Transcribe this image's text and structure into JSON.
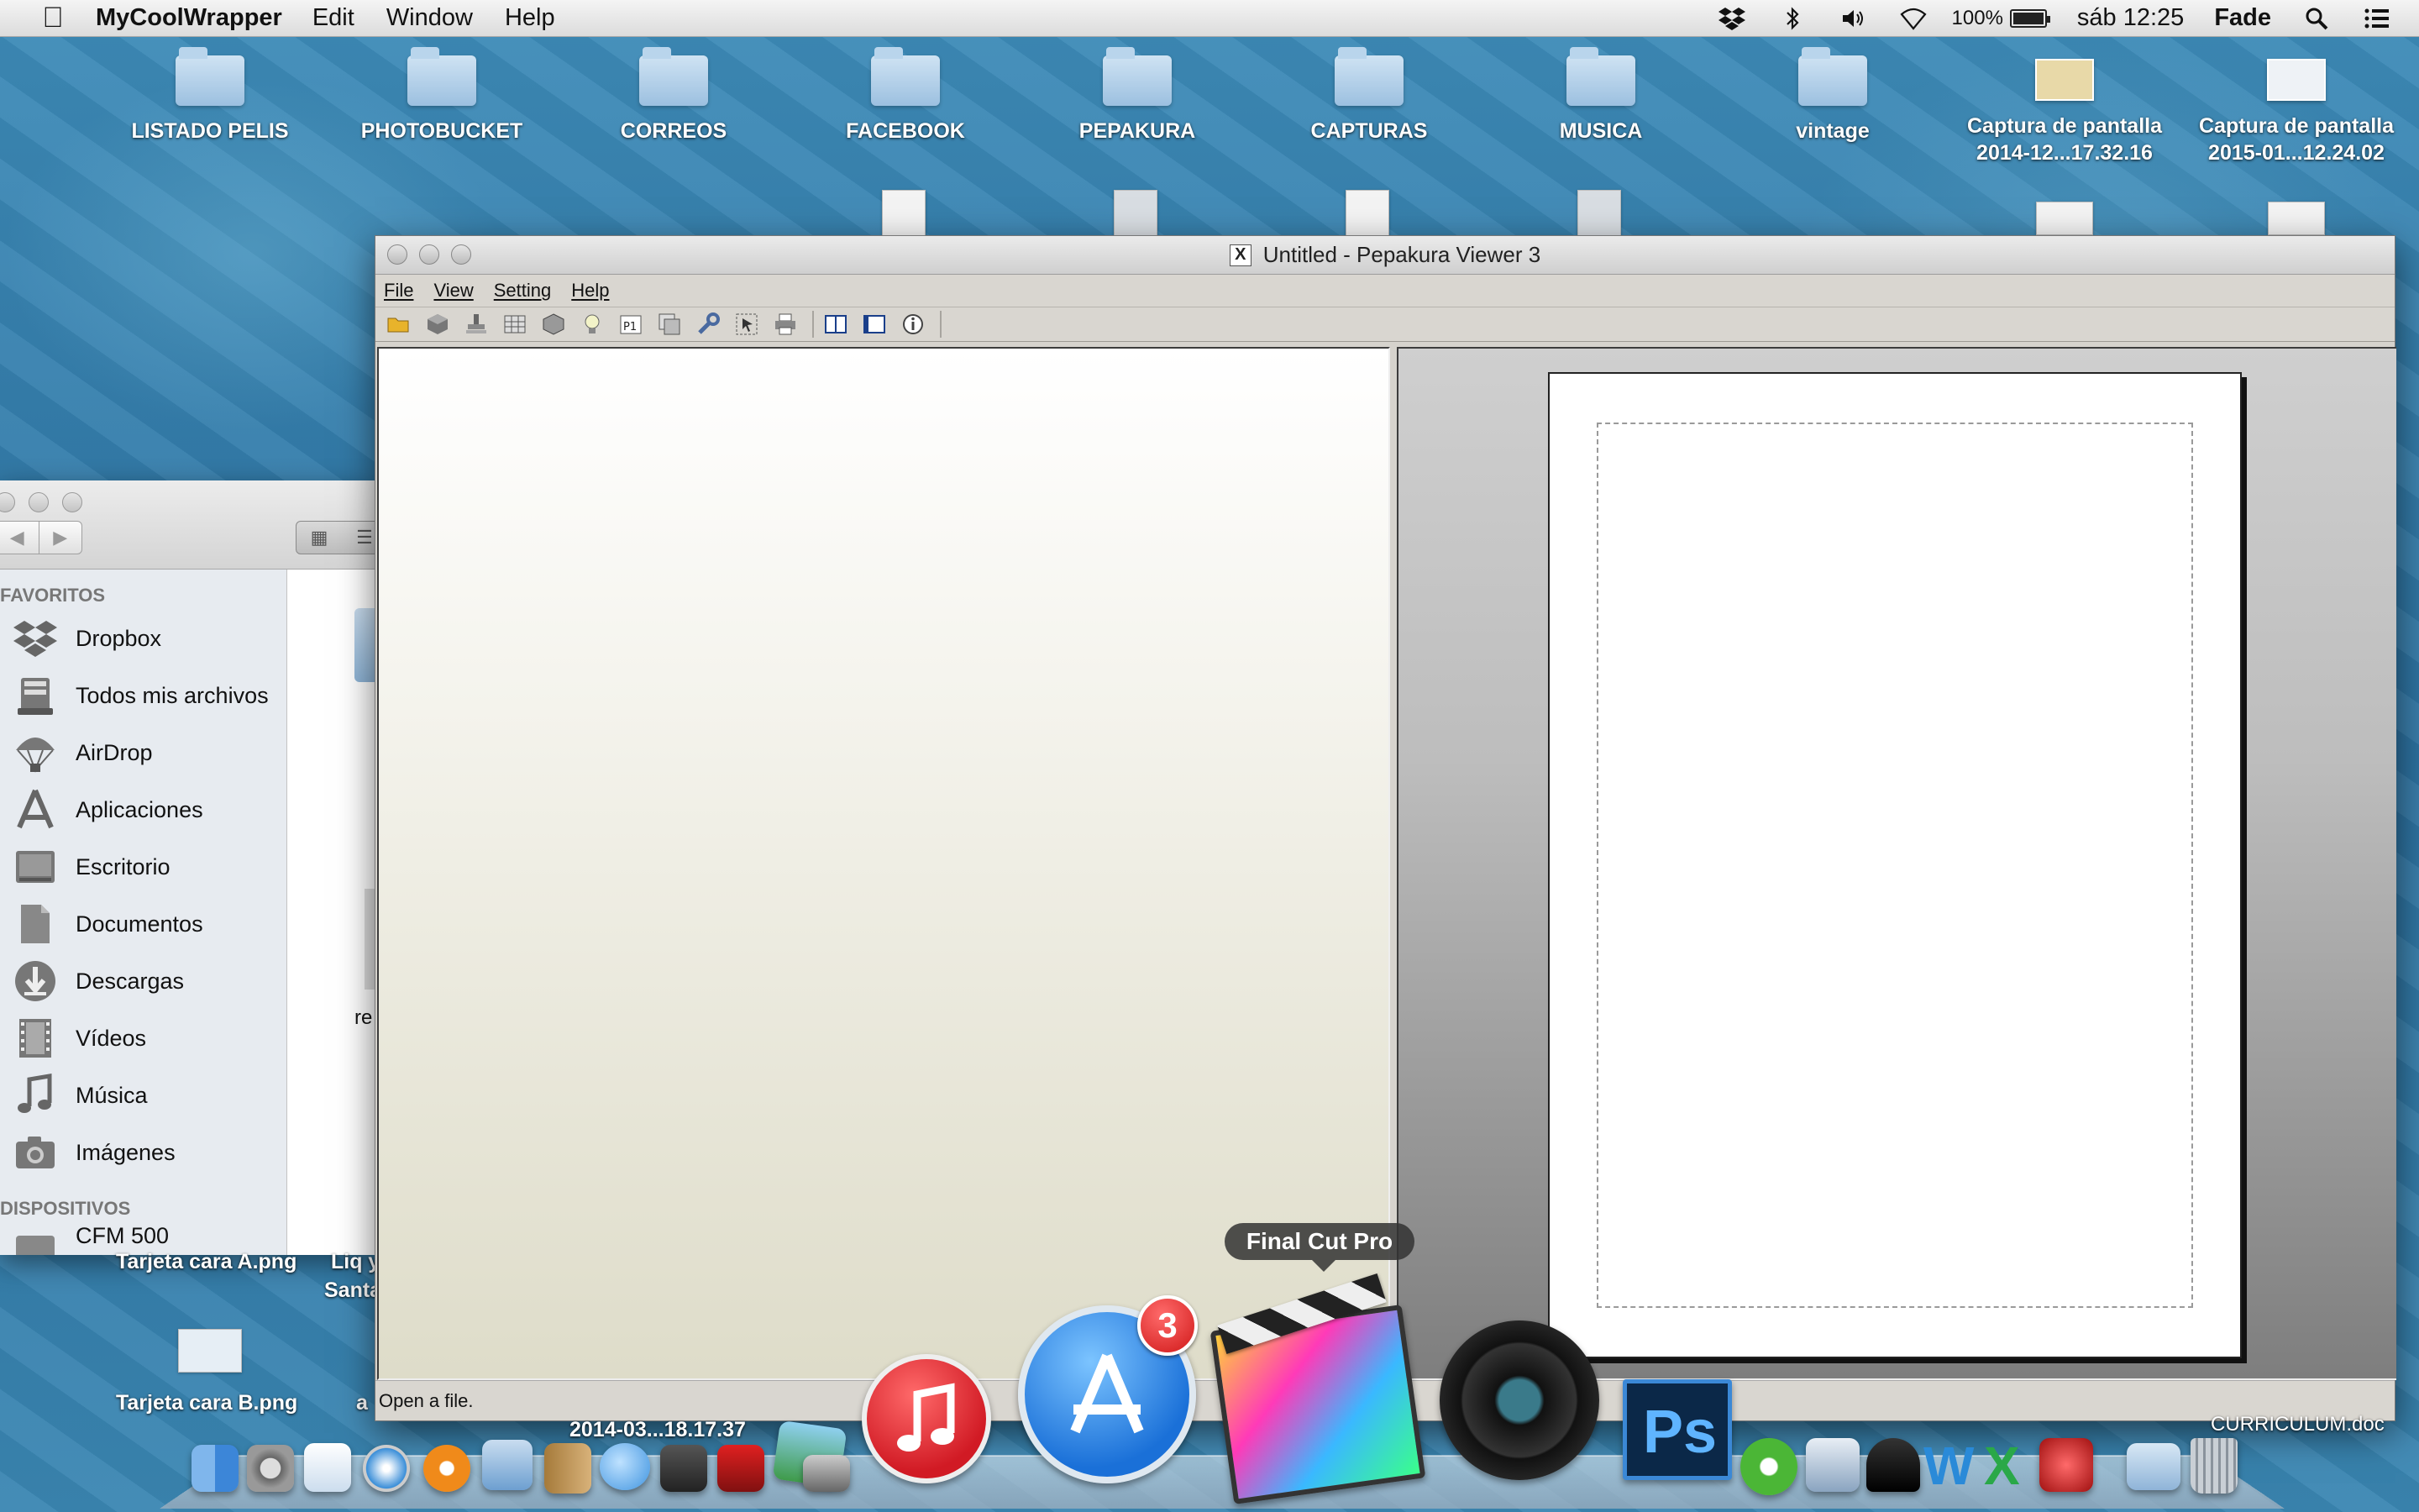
{
  "menubar": {
    "app_name": "MyCoolWrapper",
    "menus": [
      "Edit",
      "Window",
      "Help"
    ],
    "battery_text": "100%",
    "battery_level": 1.0,
    "clock": "sáb 12:25",
    "user": "Fade",
    "tray_icons": [
      "dropbox-icon",
      "bluetooth-icon",
      "volume-icon",
      "wifi-icon",
      "battery-icon",
      "spotlight-icon",
      "notifications-icon"
    ]
  },
  "desktop": {
    "folders": [
      {
        "label": "LISTADO PELIS"
      },
      {
        "label": "PHOTOBUCKET"
      },
      {
        "label": "CORREOS"
      },
      {
        "label": "FACEBOOK"
      },
      {
        "label": "PEPAKURA"
      },
      {
        "label": "CAPTURAS"
      },
      {
        "label": "MUSICA"
      },
      {
        "label": "vintage"
      }
    ],
    "screenshots": [
      {
        "line1": "Captura de pantalla",
        "line2": "2014-12...17.32.16"
      },
      {
        "line1": "Captura de pantalla",
        "line2": "2015-01...12.24.02"
      }
    ],
    "bottom_files": [
      {
        "label": "Tarjeta cara A.png"
      },
      {
        "label": "Tarjeta cara B.png"
      },
      {
        "label": "Liq y"
      },
      {
        "label": "Santa"
      },
      {
        "label": "a"
      },
      {
        "label": "2014-03...18.17.37"
      },
      {
        "label": "CURRICULUM.doc"
      }
    ]
  },
  "finder": {
    "sections": {
      "favorites": "FAVORITOS",
      "devices": "DISPOSITIVOS"
    },
    "favorites": [
      {
        "label": "Dropbox",
        "icon": "dropbox-icon"
      },
      {
        "label": "Todos mis archivos",
        "icon": "all-files-icon"
      },
      {
        "label": "AirDrop",
        "icon": "airdrop-icon"
      },
      {
        "label": "Aplicaciones",
        "icon": "applications-icon"
      },
      {
        "label": "Escritorio",
        "icon": "desktop-icon"
      },
      {
        "label": "Documentos",
        "icon": "documents-icon"
      },
      {
        "label": "Descargas",
        "icon": "downloads-icon"
      },
      {
        "label": "Vídeos",
        "icon": "movies-icon"
      },
      {
        "label": "Música",
        "icon": "music-icon"
      },
      {
        "label": "Imágenes",
        "icon": "pictures-icon"
      }
    ],
    "devices": [
      {
        "label": "CFM 500"
      }
    ],
    "partial_file_label": "re"
  },
  "pepakura": {
    "title": "Untitled - Pepakura Viewer 3",
    "menus": [
      "File",
      "View",
      "Setting",
      "Help"
    ],
    "toolbar": [
      "open-folder-icon",
      "3d-model-icon",
      "print-stamp-icon",
      "unfold-icon",
      "box-icon",
      "bulb-icon",
      "page-p1-icon",
      "layout-icon",
      "wrench-icon",
      "select-icon",
      "print-icon",
      "split-view-icon",
      "single-view-icon",
      "info-icon"
    ],
    "status": "Open a file."
  },
  "dock": {
    "tooltip": "Final Cut Pro",
    "app_store_badge": "3",
    "apps": [
      "finder",
      "system-preferences",
      "preview",
      "safari",
      "ibooks",
      "mail-stamp",
      "contacts",
      "messages",
      "facetime",
      "photo-booth",
      "iphoto",
      "image-capture",
      "itunes",
      "app-store",
      "final-cut-pro",
      "aperture",
      "photoshop",
      "utorrent",
      "network-share",
      "inkscape",
      "word",
      "excel",
      "wineskin",
      "downloads-folder",
      "trash"
    ]
  },
  "colors": {
    "wallpaper": "#2e74a3",
    "badge_red": "#d01818",
    "itunes_red": "#e0242c",
    "appstore_blue": "#1a7fe0",
    "photoshop_blue": "#0b2848"
  }
}
